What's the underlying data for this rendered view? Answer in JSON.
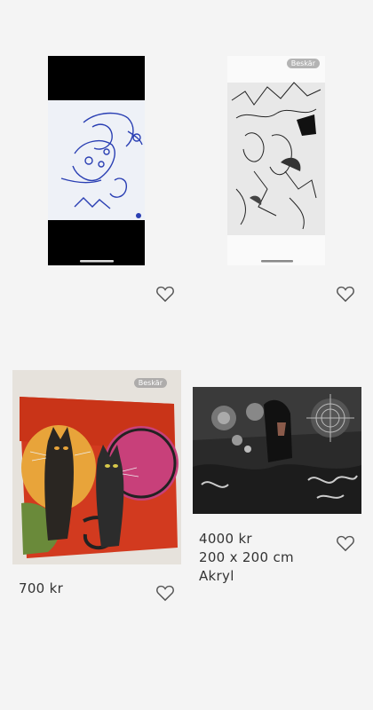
{
  "badge_label": "Beskär",
  "listings": [
    {
      "id": "item-1",
      "lines": []
    },
    {
      "id": "item-2",
      "lines": []
    },
    {
      "id": "item-3",
      "lines": [
        "700 kr"
      ]
    },
    {
      "id": "item-4",
      "lines": [
        "4000 kr",
        "200 x 200 cm",
        "Akryl"
      ]
    }
  ],
  "icons": {
    "favorite": "heart-outline-icon"
  }
}
